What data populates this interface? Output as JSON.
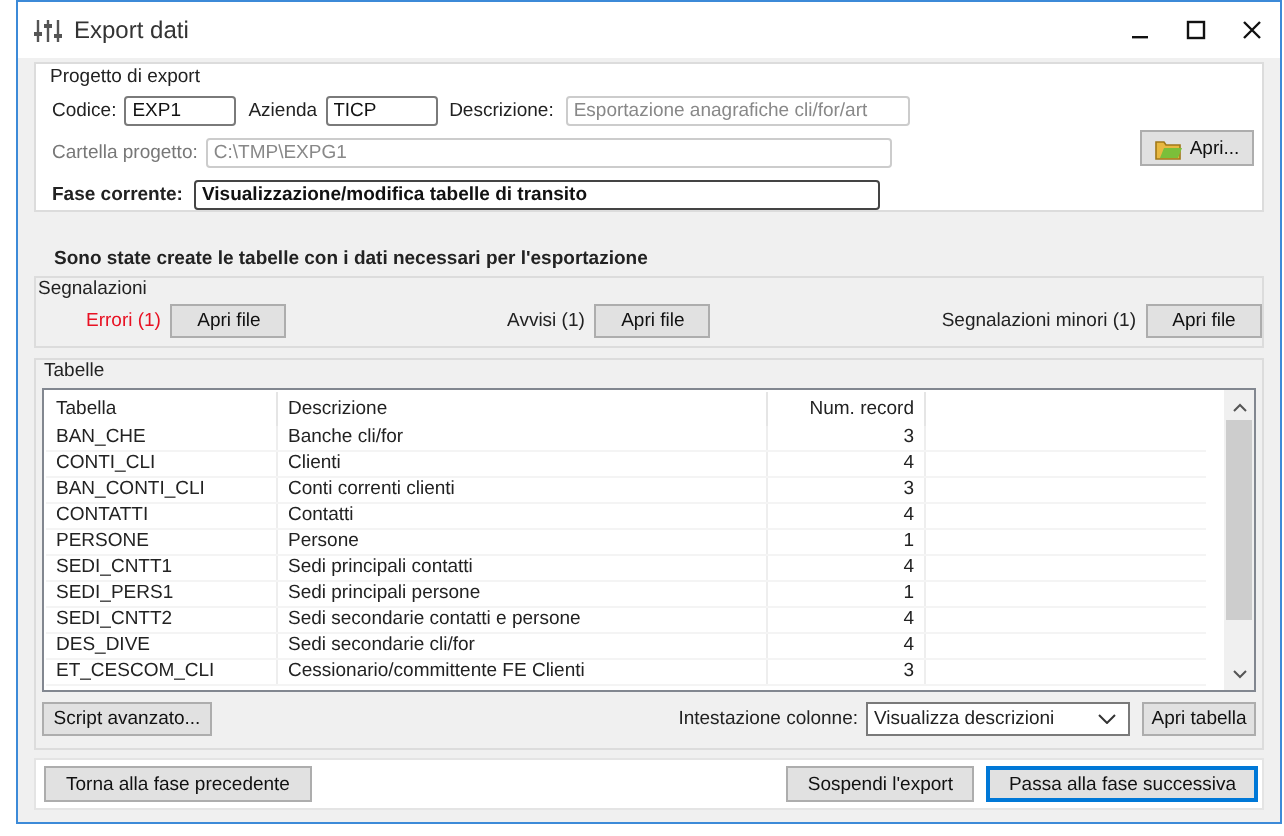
{
  "window": {
    "title": "Export dati"
  },
  "project": {
    "legend": "Progetto di export",
    "row1": [
      {
        "label": "Codice:",
        "value": "EXP1",
        "disabled": false
      },
      {
        "label": "Azienda",
        "value": "TICP",
        "disabled": false
      },
      {
        "label": "Descrizione:",
        "value": "Esportazione anagrafiche cli/for/art",
        "disabled": true
      }
    ],
    "folder": {
      "label": "Cartella progetto:",
      "value": "C:\\TMP\\EXPG1",
      "disabled": true
    },
    "phase": {
      "label": "Fase corrente:",
      "value": "Visualizzazione/modifica tabelle di transito"
    },
    "open_button": "Apri..."
  },
  "message": "Sono state create le tabelle con i dati necessari per l'esportazione",
  "reports": {
    "legend": "Segnalazioni",
    "items": [
      {
        "label": "Errori (1)",
        "color": "#e81123",
        "button": "Apri file"
      },
      {
        "label": "Avvisi (1)",
        "color": "#222222",
        "button": "Apri file"
      },
      {
        "label": "Segnalazioni minori (1)",
        "color": "#222222",
        "button": "Apri file"
      }
    ]
  },
  "tables": {
    "legend": "Tabelle",
    "columns": [
      "Tabella",
      "Descrizione",
      "Num. record"
    ],
    "rows": [
      [
        "BAN_CHE",
        "Banche cli/for",
        "3"
      ],
      [
        "CONTI_CLI",
        "Clienti",
        "4"
      ],
      [
        "BAN_CONTI_CLI",
        "Conti correnti clienti",
        "3"
      ],
      [
        "CONTATTI",
        "Contatti",
        "4"
      ],
      [
        "PERSONE",
        "Persone",
        "1"
      ],
      [
        "SEDI_CNTT1",
        "Sedi principali contatti",
        "4"
      ],
      [
        "SEDI_PERS1",
        "Sedi principali persone",
        "1"
      ],
      [
        "SEDI_CNTT2",
        "Sedi secondarie contatti e persone",
        "4"
      ],
      [
        "DES_DIVE",
        "Sedi secondarie cli/for",
        "4"
      ],
      [
        "ET_CESCOM_CLI",
        "Cessionario/committente FE Clienti",
        "3"
      ]
    ],
    "script_button": "Script avanzato...",
    "header_label": "Intestazione colonne:",
    "header_select": "Visualizza descrizioni",
    "open_table_button": "Apri tabella"
  },
  "footer": [
    {
      "label": "Torna alla fase precedente",
      "focused": false
    },
    {
      "label": "Sospendi l'export",
      "focused": false
    },
    {
      "label": "Passa alla fase successiva",
      "focused": true
    }
  ]
}
